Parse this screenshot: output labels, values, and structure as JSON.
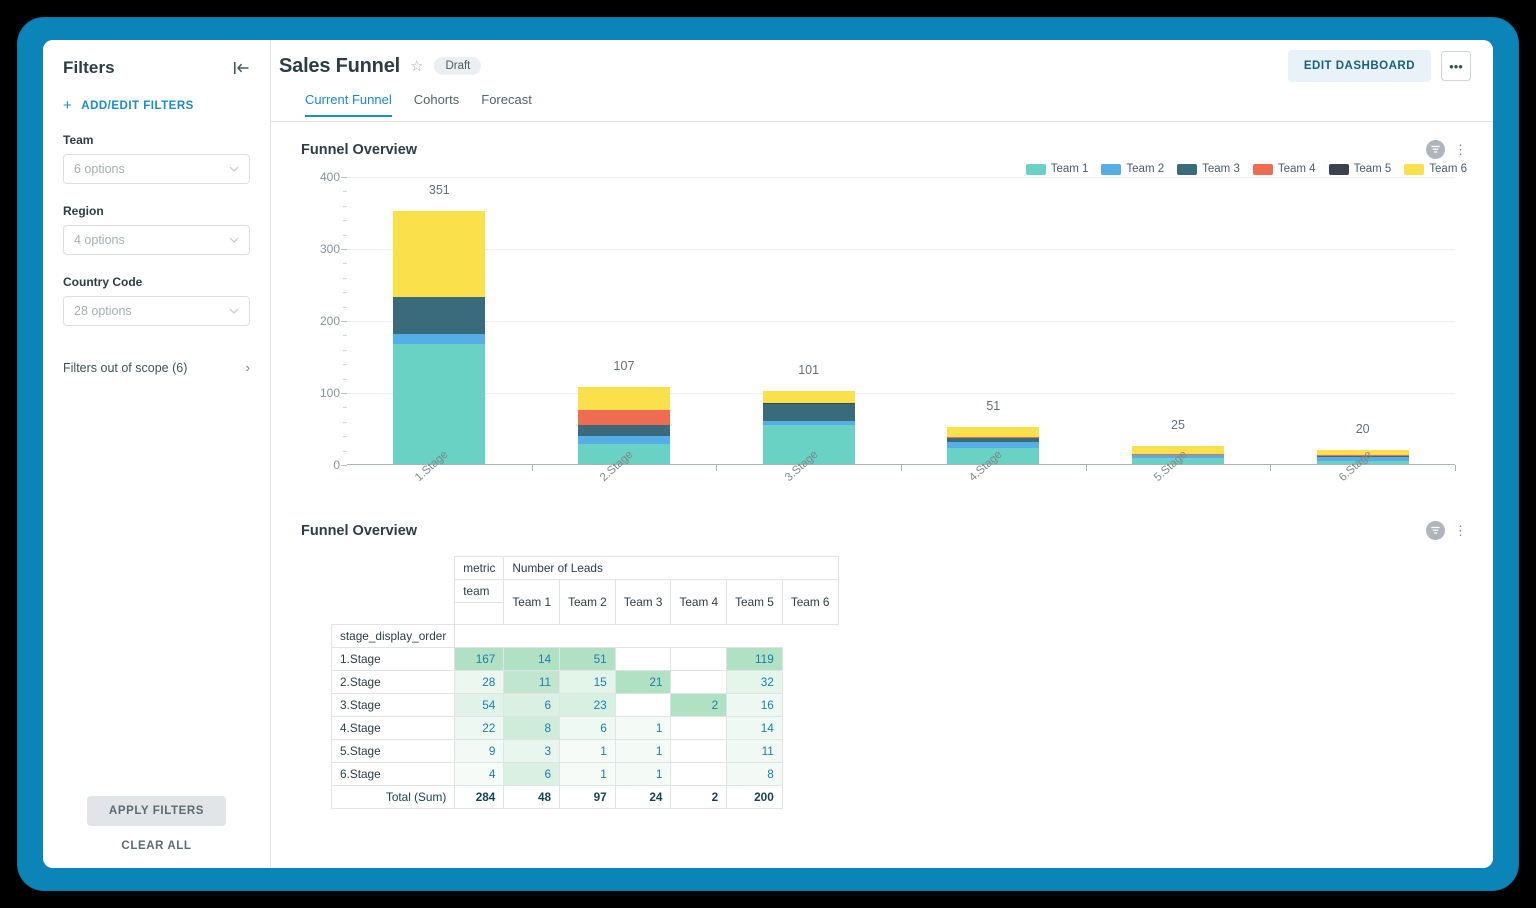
{
  "sidebar": {
    "title": "Filters",
    "collapse_icon": "collapse-panel-icon",
    "add_edit_filters": "ADD/EDIT FILTERS",
    "filters": [
      {
        "label": "Team",
        "value": "6 options"
      },
      {
        "label": "Region",
        "value": "4 options"
      },
      {
        "label": "Country Code",
        "value": "28 options"
      }
    ],
    "out_of_scope": "Filters out of scope (6)",
    "apply_label": "APPLY FILTERS",
    "clear_label": "CLEAR ALL"
  },
  "header": {
    "title": "Sales Funnel",
    "star_icon": "star-outline-icon",
    "status_badge": "Draft",
    "edit_dashboard": "EDIT DASHBOARD",
    "more_menu": "•••"
  },
  "tabs": [
    {
      "label": "Current Funnel",
      "active": true
    },
    {
      "label": "Cohorts",
      "active": false
    },
    {
      "label": "Forecast",
      "active": false
    }
  ],
  "chart_card": {
    "title": "Funnel Overview",
    "filter_icon": "chart-filter-icon",
    "menu_icon": "vertical-dots-icon"
  },
  "table_card": {
    "title": "Funnel Overview",
    "filter_icon": "chart-filter-icon",
    "menu_icon": "vertical-dots-icon"
  },
  "chart_data": {
    "type": "bar",
    "title": "Funnel Overview",
    "stacked": true,
    "xlabel": "",
    "ylabel": "",
    "ylim": [
      0,
      400
    ],
    "yticks": [
      0,
      100,
      200,
      300,
      400
    ],
    "minor_ticks_between": 4,
    "grid": true,
    "legend_position": "top-right",
    "categories": [
      "1.Stage",
      "2.Stage",
      "3.Stage",
      "4.Stage",
      "5.Stage",
      "6.Stage"
    ],
    "totals": [
      351,
      107,
      101,
      51,
      25,
      20
    ],
    "series": [
      {
        "name": "Team 1",
        "color": "#69d2c4",
        "values": [
          167,
          28,
          54,
          22,
          9,
          4
        ]
      },
      {
        "name": "Team 2",
        "color": "#57aee6",
        "values": [
          14,
          11,
          6,
          8,
          3,
          6
        ]
      },
      {
        "name": "Team 3",
        "color": "#3a6b7a",
        "values": [
          51,
          15,
          23,
          6,
          1,
          1
        ]
      },
      {
        "name": "Team 4",
        "color": "#ef6b52",
        "values": [
          0,
          21,
          0,
          1,
          1,
          1
        ]
      },
      {
        "name": "Team 5",
        "color": "#3c4250",
        "values": [
          0,
          0,
          2,
          0,
          0,
          0
        ]
      },
      {
        "name": "Team 6",
        "color": "#fae04b",
        "values": [
          119,
          32,
          16,
          14,
          11,
          8
        ]
      }
    ]
  },
  "table_data": {
    "corner_label": "stage_display_order",
    "metric_label": "metric",
    "metric_value": "Number of Leads",
    "team_label": "team",
    "team_headers": [
      "Team 1",
      "Team 2",
      "Team 3",
      "Team 4",
      "Team 5",
      "Team 6"
    ],
    "rows": [
      {
        "stage": "1.Stage",
        "values": [
          "167",
          "14",
          "51",
          "",
          "",
          "119"
        ]
      },
      {
        "stage": "2.Stage",
        "values": [
          "28",
          "11",
          "15",
          "21",
          "",
          "32"
        ]
      },
      {
        "stage": "3.Stage",
        "values": [
          "54",
          "6",
          "23",
          "",
          "2",
          "16"
        ]
      },
      {
        "stage": "4.Stage",
        "values": [
          "22",
          "8",
          "6",
          "1",
          "",
          "14"
        ]
      },
      {
        "stage": "5.Stage",
        "values": [
          "9",
          "3",
          "1",
          "1",
          "",
          "11"
        ]
      },
      {
        "stage": "6.Stage",
        "values": [
          "4",
          "6",
          "1",
          "1",
          "",
          "8"
        ]
      }
    ],
    "total_label": "Total (Sum)",
    "totals": [
      "284",
      "48",
      "97",
      "24",
      "2",
      "200"
    ]
  },
  "colors": {
    "frame": "#0b85b8",
    "accent": "#1a8cc8",
    "heatmap_high": "#9ed9b4",
    "heatmap_low": "#f3fbf6"
  }
}
